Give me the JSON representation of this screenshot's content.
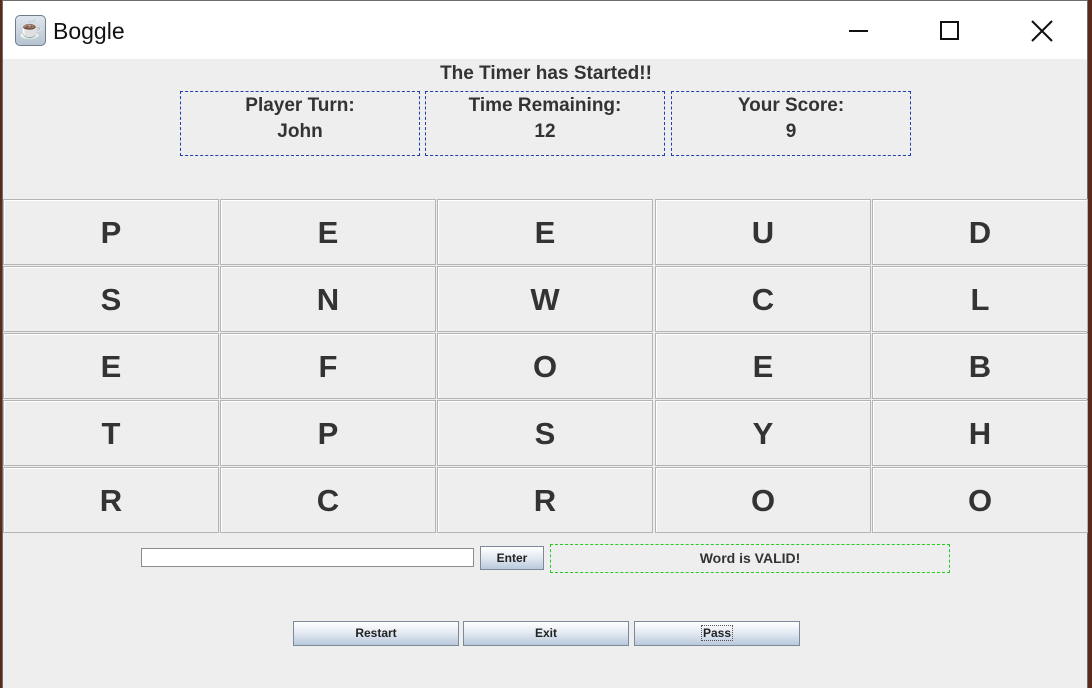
{
  "window": {
    "title": "Boggle",
    "icon": "java-cup-icon"
  },
  "status": {
    "message": "The Timer has Started!!"
  },
  "info": {
    "player_label": "Player Turn:",
    "player_value": "John",
    "time_label": "Time Remaining:",
    "time_value": "12",
    "score_label": "Your Score:",
    "score_value": "9"
  },
  "board": {
    "rows": [
      [
        "P",
        "E",
        "E",
        "U",
        "D"
      ],
      [
        "S",
        "N",
        "W",
        "C",
        "L"
      ],
      [
        "E",
        "F",
        "O",
        "E",
        "B"
      ],
      [
        "T",
        "P",
        "S",
        "Y",
        "H"
      ],
      [
        "R",
        "C",
        "R",
        "O",
        "O"
      ]
    ]
  },
  "word_entry": {
    "value": "",
    "enter_label": "Enter",
    "message": "Word is VALID!"
  },
  "controls": {
    "restart_label": "Restart",
    "exit_label": "Exit",
    "pass_label": "Pass"
  },
  "colors": {
    "info_border": "#1f3fae",
    "message_border": "#22cc22",
    "background": "#eeeeee"
  }
}
